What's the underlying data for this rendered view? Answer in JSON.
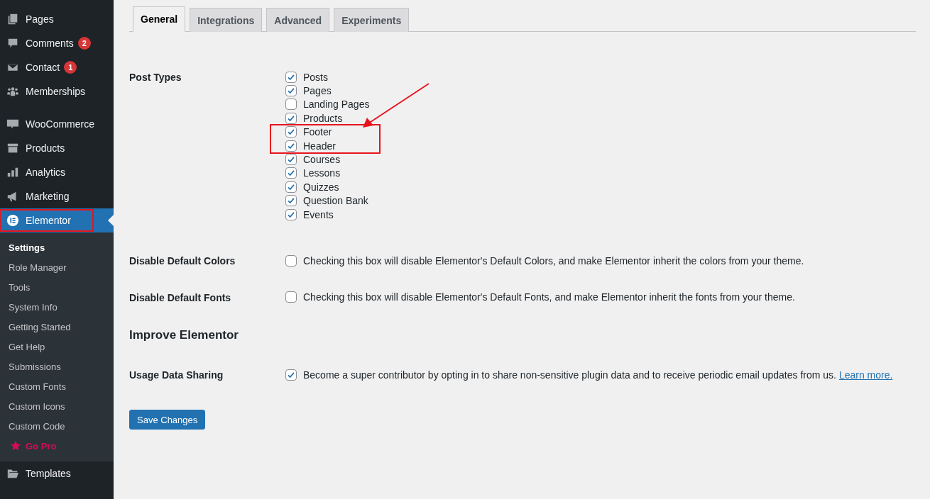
{
  "sidebar": {
    "items": [
      {
        "label": "Pages",
        "selected": false
      },
      {
        "label": "Comments",
        "badge": "2",
        "selected": false
      },
      {
        "label": "Contact",
        "badge": "1",
        "selected": false
      },
      {
        "label": "Memberships",
        "selected": false
      },
      {
        "label": "WooCommerce",
        "selected": false
      },
      {
        "label": "Products",
        "selected": false
      },
      {
        "label": "Analytics",
        "selected": false
      },
      {
        "label": "Marketing",
        "selected": false
      },
      {
        "label": "Elementor",
        "selected": true,
        "highlighted": true,
        "submenu": [
          {
            "label": "Settings",
            "selected": true
          },
          {
            "label": "Role Manager",
            "selected": false
          },
          {
            "label": "Tools",
            "selected": false
          },
          {
            "label": "System Info",
            "selected": false
          },
          {
            "label": "Getting Started",
            "selected": false
          },
          {
            "label": "Get Help",
            "selected": false
          },
          {
            "label": "Submissions",
            "selected": false
          },
          {
            "label": "Custom Fonts",
            "selected": false
          },
          {
            "label": "Custom Icons",
            "selected": false
          },
          {
            "label": "Custom Code",
            "selected": false
          },
          {
            "label": "Go Pro",
            "selected": false,
            "kind": "promo"
          }
        ]
      },
      {
        "label": "Templates",
        "selected": false
      }
    ]
  },
  "tabs": [
    {
      "label": "General",
      "selected": true
    },
    {
      "label": "Integrations",
      "selected": false
    },
    {
      "label": "Advanced",
      "selected": false
    },
    {
      "label": "Experiments",
      "selected": false
    }
  ],
  "post_types": {
    "label": "Post Types",
    "items": [
      {
        "label": "Posts",
        "checked": true,
        "highlighted": false
      },
      {
        "label": "Pages",
        "checked": true,
        "highlighted": false
      },
      {
        "label": "Landing Pages",
        "checked": false,
        "highlighted": false
      },
      {
        "label": "Products",
        "checked": true,
        "highlighted": false
      },
      {
        "label": "Footer",
        "checked": true,
        "highlighted": true
      },
      {
        "label": "Header",
        "checked": true,
        "highlighted": true
      },
      {
        "label": "Courses",
        "checked": true,
        "highlighted": false
      },
      {
        "label": "Lessons",
        "checked": true,
        "highlighted": false
      },
      {
        "label": "Quizzes",
        "checked": true,
        "highlighted": false
      },
      {
        "label": "Question Bank",
        "checked": true,
        "highlighted": false
      },
      {
        "label": "Events",
        "checked": true,
        "highlighted": false
      }
    ]
  },
  "annotation_arrow": true,
  "settings": [
    {
      "label": "Disable Default Colors",
      "checked": false,
      "description": "Checking this box will disable Elementor's Default Colors, and make Elementor inherit the colors from your theme."
    },
    {
      "label": "Disable Default Fonts",
      "checked": false,
      "description": "Checking this box will disable Elementor's Default Fonts, and make Elementor inherit the fonts from your theme."
    }
  ],
  "section_heading": "Improve Elementor",
  "usage": {
    "label": "Usage Data Sharing",
    "checked": true,
    "description": "Become a super contributor by opting in to share non-sensitive plugin data and to receive periodic email updates from us.",
    "link": "Learn more."
  },
  "save_button": "Save Changes"
}
